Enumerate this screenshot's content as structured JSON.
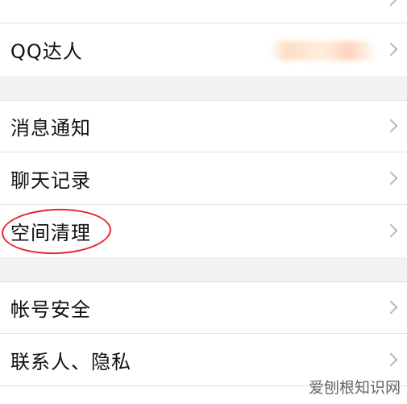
{
  "groups": [
    {
      "items": [
        {
          "label": "QQ达人"
        }
      ]
    },
    {
      "items": [
        {
          "label": "消息通知"
        },
        {
          "label": "聊天记录"
        },
        {
          "label": "空间清理"
        }
      ]
    },
    {
      "items": [
        {
          "label": "帐号安全"
        },
        {
          "label": "联系人、隐私"
        }
      ]
    }
  ],
  "watermark": "爱刨根知识网",
  "colors": {
    "background": "#f2f2f4",
    "row": "#ffffff",
    "separator": "#e3e3e6",
    "chevron": "#b8b8bc",
    "highlight": "#e5262d"
  }
}
